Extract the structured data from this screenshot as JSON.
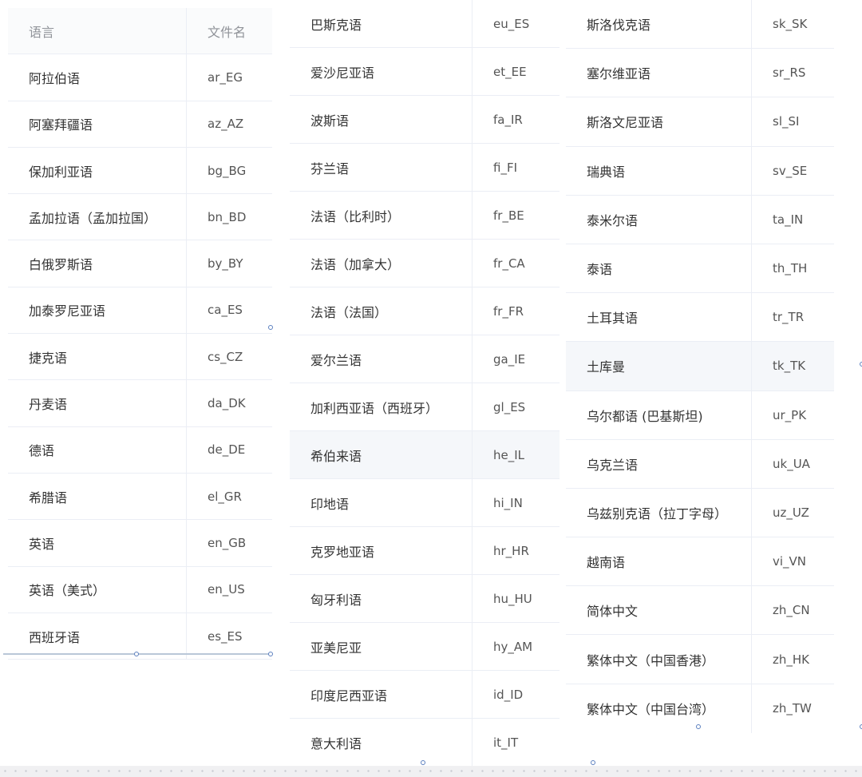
{
  "table1": {
    "header": {
      "lang": "语言",
      "file": "文件名"
    },
    "rows": [
      {
        "lang": "阿拉伯语",
        "code": "ar_EG"
      },
      {
        "lang": "阿塞拜疆语",
        "code": "az_AZ"
      },
      {
        "lang": "保加利亚语",
        "code": "bg_BG"
      },
      {
        "lang": "孟加拉语（孟加拉国）",
        "code": "bn_BD"
      },
      {
        "lang": "白俄罗斯语",
        "code": "by_BY"
      },
      {
        "lang": "加泰罗尼亚语",
        "code": "ca_ES"
      },
      {
        "lang": "捷克语",
        "code": "cs_CZ"
      },
      {
        "lang": "丹麦语",
        "code": "da_DK"
      },
      {
        "lang": "德语",
        "code": "de_DE"
      },
      {
        "lang": "希腊语",
        "code": "el_GR"
      },
      {
        "lang": "英语",
        "code": "en_GB"
      },
      {
        "lang": "英语（美式）",
        "code": "en_US"
      },
      {
        "lang": "西班牙语",
        "code": "es_ES"
      }
    ]
  },
  "table2": {
    "rows": [
      {
        "lang": "巴斯克语",
        "code": "eu_ES"
      },
      {
        "lang": "爱沙尼亚语",
        "code": "et_EE"
      },
      {
        "lang": "波斯语",
        "code": "fa_IR"
      },
      {
        "lang": "芬兰语",
        "code": "fi_FI"
      },
      {
        "lang": "法语（比利时）",
        "code": "fr_BE"
      },
      {
        "lang": "法语（加拿大）",
        "code": "fr_CA"
      },
      {
        "lang": "法语（法国）",
        "code": "fr_FR"
      },
      {
        "lang": "爱尔兰语",
        "code": "ga_IE"
      },
      {
        "lang": "加利西亚语（西班牙）",
        "code": "gl_ES"
      },
      {
        "lang": "希伯来语",
        "code": "he_IL"
      },
      {
        "lang": "印地语",
        "code": "hi_IN"
      },
      {
        "lang": "克罗地亚语",
        "code": "hr_HR"
      },
      {
        "lang": "匈牙利语",
        "code": "hu_HU"
      },
      {
        "lang": "亚美尼亚",
        "code": "hy_AM"
      },
      {
        "lang": "印度尼西亚语",
        "code": "id_ID"
      },
      {
        "lang": "意大利语",
        "code": "it_IT"
      }
    ]
  },
  "table3": {
    "rows": [
      {
        "lang": "斯洛伐克语",
        "code": "sk_SK"
      },
      {
        "lang": "塞尔维亚语",
        "code": "sr_RS"
      },
      {
        "lang": "斯洛文尼亚语",
        "code": "sl_SI"
      },
      {
        "lang": "瑞典语",
        "code": "sv_SE"
      },
      {
        "lang": "泰米尔语",
        "code": "ta_IN"
      },
      {
        "lang": "泰语",
        "code": "th_TH"
      },
      {
        "lang": "土耳其语",
        "code": "tr_TR"
      },
      {
        "lang": "土库曼",
        "code": "tk_TK"
      },
      {
        "lang": "乌尔都语 (巴基斯坦)",
        "code": "ur_PK"
      },
      {
        "lang": "乌克兰语",
        "code": "uk_UA"
      },
      {
        "lang": "乌兹别克语（拉丁字母）",
        "code": "uz_UZ"
      },
      {
        "lang": "越南语",
        "code": "vi_VN"
      },
      {
        "lang": "简体中文",
        "code": "zh_CN"
      },
      {
        "lang": "繁体中文（中国香港）",
        "code": "zh_HK"
      },
      {
        "lang": "繁体中文（中国台湾）",
        "code": "zh_TW"
      }
    ]
  }
}
